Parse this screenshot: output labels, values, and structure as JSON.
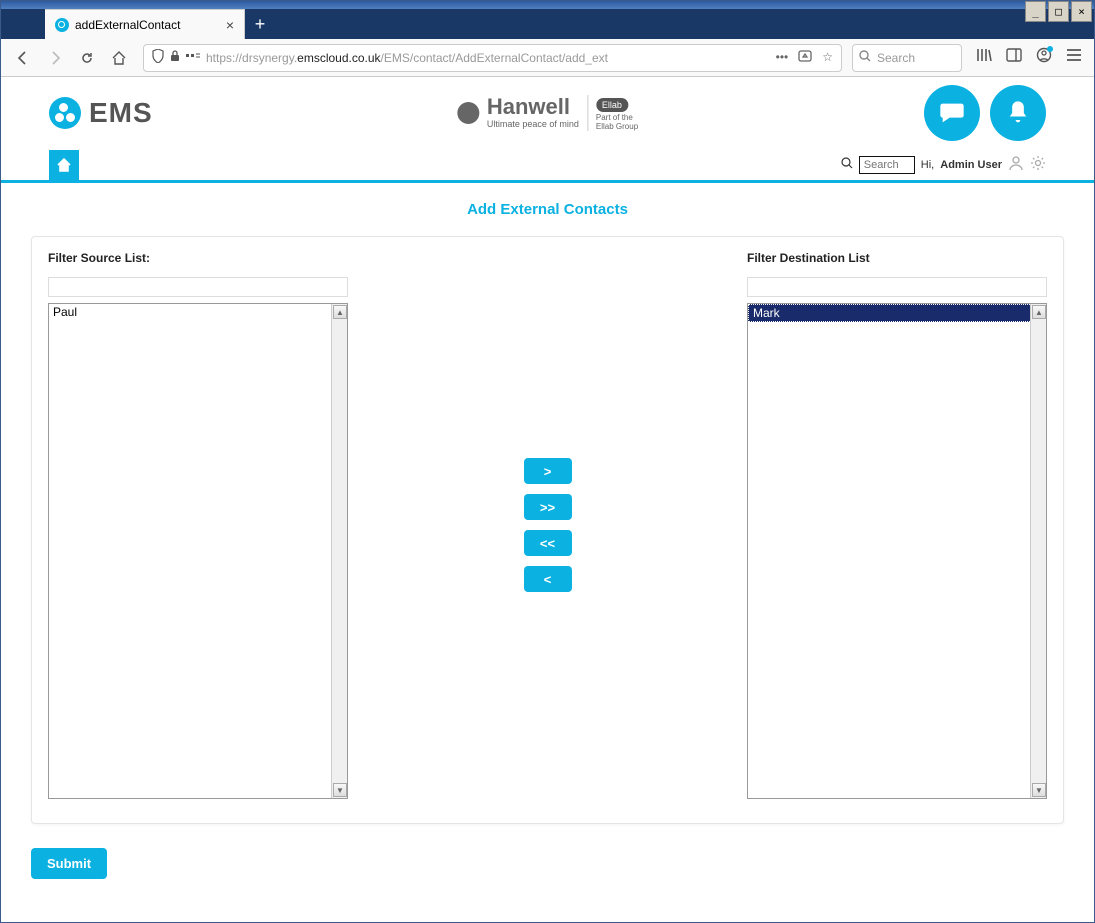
{
  "window": {
    "minimize": "_",
    "maximize": "□",
    "close": "×"
  },
  "tab": {
    "title": "addExternalContact"
  },
  "nav": {
    "url_prefix": "https://drsynergy.",
    "url_host": "emscloud.co.uk",
    "url_path": "/EMS/contact/AddExternalContact/add_ext",
    "search_placeholder": "Search"
  },
  "app": {
    "ems_text": "EMS",
    "hanwell": "Hanwell",
    "hanwell_sub": "Ultimate peace of mind",
    "ellab": "Ellab",
    "ellab_sub1": "Part of the",
    "ellab_sub2": "Ellab Group"
  },
  "toolbar": {
    "search_placeholder": "Search",
    "greeting": "Hi,",
    "username": "Admin User"
  },
  "page": {
    "title": "Add External Contacts",
    "source_label": "Filter Source List:",
    "dest_label": "Filter Destination List",
    "move_right": ">",
    "move_all_right": ">>",
    "move_all_left": "<<",
    "move_left": "<",
    "submit": "Submit",
    "source_items": {
      "0": "Paul"
    },
    "dest_items": {
      "0": "Mark"
    }
  }
}
